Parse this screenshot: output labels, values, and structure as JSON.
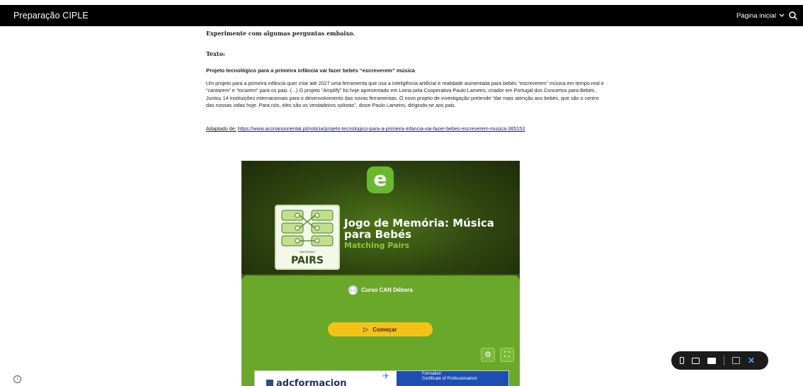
{
  "header": {
    "site_title": "Preparação CIPLE",
    "nav_home": "Página inicial"
  },
  "content": {
    "intro": "Experimente com algumas perguntas embaixo.",
    "label_text": "Texto:",
    "article_title": "Projeto tecnológico para a primeira infância vai fazer bebés “escreverem” música",
    "article_body": "Um projeto para a primeira infância quer criar até 2027 uma ferramenta que usa a inteligência artificial e realidade aumentada para bebés “escreverem” música em tempo real e “cantarem” e “tocarem” para os pais. (...) O projeto “Amplify” foi hoje apresentado em Leiria pela Cooperativa Paulo Lameiro, criador em Portugal dos Concertos para Bebés. Juntou 14 instituições internacionais para o desenvolvimento das novas ferramentas. O novo projeto de investigação pretende “dar mais atenção aos bebés, que são o centro das nossas vidas hoje. Para nós, eles são os verdadeiros solistas”, disse Paulo Lameiro, dirigindo-se aos pais.",
    "source_label": "Adaptado de:",
    "source_url": "https://www.acorianooriental.pt/noticia/projeto-tecnologico-para-a-primeira-infancia-vai-fazer-bebes-escreverem-musica-365153"
  },
  "game": {
    "logo_letter": "e",
    "card_small": "MATCHING",
    "card_word": "PAIRS",
    "title": "Jogo de Memória: Música para Bebés",
    "subtitle": "Matching Pairs",
    "author": "Curso CAN Débora",
    "start_label": "Começar",
    "ad_brand": "adcformacion",
    "ad_line1": "Formation",
    "ad_line2": "Certificate of Professionalism"
  },
  "colors": {
    "topbar": "#000000",
    "game_green": "#6aa82a",
    "start_button": "#f4c216"
  },
  "icons": [
    "search-icon",
    "chevron-down-icon",
    "settings-icon",
    "fullscreen-icon",
    "phone-icon",
    "tablet-icon",
    "laptop-icon",
    "book-icon",
    "close-icon",
    "info-icon",
    "play-icon"
  ]
}
